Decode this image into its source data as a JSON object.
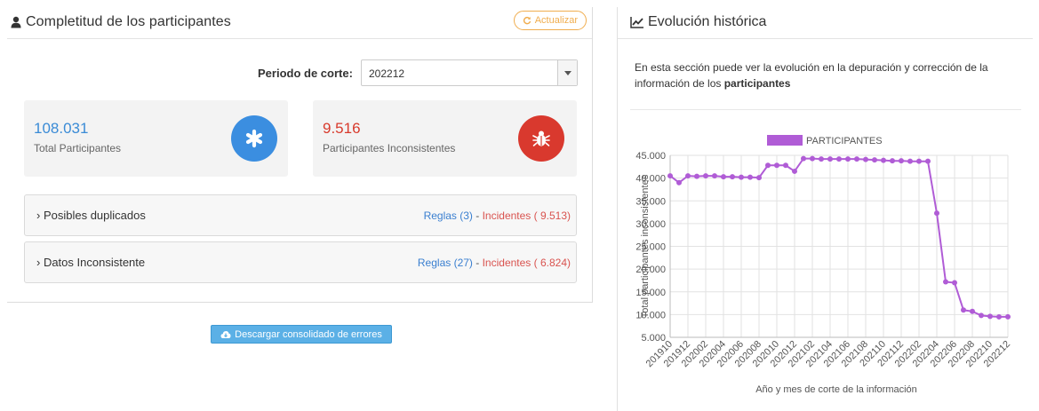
{
  "left": {
    "title": "Completitud de los participantes",
    "refresh_label": "Actualizar",
    "period_label": "Periodo de corte:",
    "period_value": "202212",
    "stats": {
      "total_value": "108.031",
      "total_label": "Total Participantes",
      "incons_value": "9.516",
      "incons_label": "Participantes Inconsistentes"
    },
    "accordion": [
      {
        "title": "› Posibles duplicados",
        "rules": "Reglas (3)",
        "sep": " - ",
        "incidents": "Incidentes ( 9.513)"
      },
      {
        "title": "› Datos Inconsistente",
        "rules": "Reglas (27)",
        "sep": " - ",
        "incidents": "Incidentes ( 6.824)"
      }
    ],
    "download_label": "Descargar consolidado de errores"
  },
  "right": {
    "title": "Evolución histórica",
    "desc_prefix": "En esta sección puede ver la evolución en la depuración y corrección de la información de los ",
    "desc_bold": "participantes"
  },
  "colors": {
    "accent_blue": "#3b8ee0",
    "danger_red": "#d9392e",
    "warning_orange": "#f0ad4e",
    "series_purple": "#b05cd6"
  },
  "chart_data": {
    "type": "line",
    "legend_position": "top",
    "grid": true,
    "xlabel": "Año y mes de corte de la información",
    "ylabel": "Total participantes inconsistentes",
    "ylim": [
      5000,
      45000
    ],
    "yticks": [
      "5.000",
      "10.000",
      "15.000",
      "20.000",
      "25.000",
      "30.000",
      "35.000",
      "40.000",
      "45.000"
    ],
    "xticks": [
      "201910",
      "201912",
      "202002",
      "202004",
      "202006",
      "202008",
      "202010",
      "202012",
      "202102",
      "202104",
      "202106",
      "202108",
      "202110",
      "202112",
      "202202",
      "202204",
      "202206",
      "202208",
      "202210",
      "202212"
    ],
    "x": [
      "201910",
      "201911",
      "201912",
      "202001",
      "202002",
      "202003",
      "202004",
      "202005",
      "202006",
      "202007",
      "202008",
      "202009",
      "202010",
      "202011",
      "202012",
      "202101",
      "202102",
      "202103",
      "202104",
      "202105",
      "202106",
      "202107",
      "202108",
      "202109",
      "202110",
      "202111",
      "202112",
      "202201",
      "202202",
      "202203",
      "202204",
      "202205",
      "202206",
      "202207",
      "202208",
      "202209",
      "202210",
      "202211",
      "202212"
    ],
    "series": [
      {
        "name": "PARTICIPANTES",
        "values": [
          40500,
          39000,
          40500,
          40400,
          40500,
          40500,
          40300,
          40300,
          40200,
          40200,
          40100,
          42800,
          42800,
          42800,
          41500,
          44300,
          44300,
          44200,
          44200,
          44200,
          44200,
          44200,
          44100,
          44000,
          43900,
          43800,
          43800,
          43700,
          43700,
          43700,
          32300,
          17200,
          17000,
          11000,
          10700,
          9800,
          9600,
          9500,
          9516
        ]
      }
    ]
  }
}
